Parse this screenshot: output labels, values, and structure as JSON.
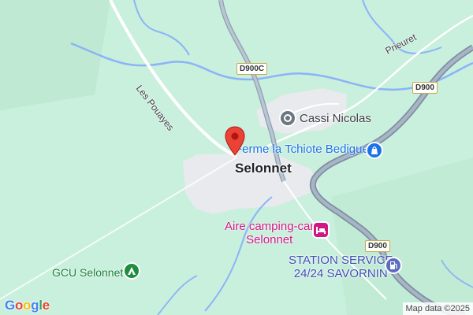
{
  "map": {
    "place_name": "Selonnet",
    "streets": {
      "les_pouayes": "Les Pouayes",
      "prieuret": "Prieuret"
    },
    "road_shields": {
      "d900c": "D900C",
      "d900_north": "D900",
      "d900_south": "D900"
    },
    "pois": {
      "cassi": {
        "label": "Cassi Nicolas",
        "icon": "store-icon"
      },
      "ferme": {
        "label": "Ferme la Tchiote Bedigue",
        "icon": "shopping-bag-icon"
      },
      "aire": {
        "line1": "Aire camping-car",
        "line2": "Selonnet",
        "icon": "hotel-bed-icon"
      },
      "station": {
        "line1": "STATION SERVICE",
        "line2": "24/24 SAVORNIN",
        "icon": "fuel-pump-icon"
      },
      "gcu": {
        "label": "GCU Selonnet",
        "icon": "campground-icon"
      }
    },
    "branding": {
      "logo_letters": [
        "G",
        "o",
        "o",
        "g",
        "l",
        "e"
      ],
      "logo_colors": [
        "#4285F4",
        "#EA4335",
        "#FBBC05",
        "#4285F4",
        "#34A853",
        "#EA4335"
      ],
      "attribution": "Map data ©2025"
    },
    "colors": {
      "land": "#c9efdd",
      "water": "#8ab4f8",
      "highway": "#8fa0b2",
      "urban": "#e8eaed",
      "marker": "#ea4335"
    }
  }
}
